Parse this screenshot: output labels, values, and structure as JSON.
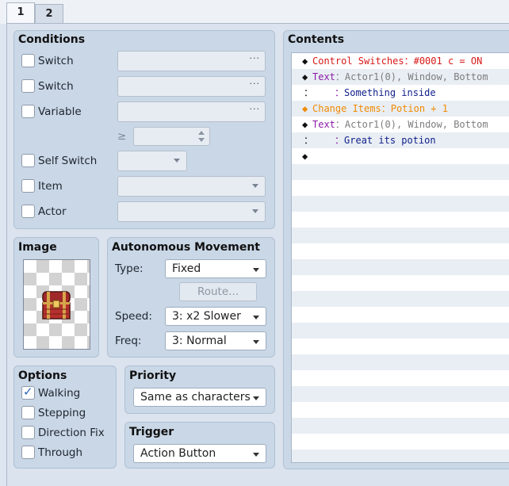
{
  "tabs": [
    "1",
    "2"
  ],
  "conditions": {
    "title": "Conditions",
    "switch1_label": "Switch",
    "switch2_label": "Switch",
    "variable_label": "Variable",
    "ge_symbol": "≥",
    "self_switch_label": "Self Switch",
    "item_label": "Item",
    "actor_label": "Actor",
    "ellipsis": "···"
  },
  "image": {
    "title": "Image",
    "icon": "treasure-chest"
  },
  "movement": {
    "title": "Autonomous Movement",
    "type_label": "Type:",
    "type_value": "Fixed",
    "route_label": "Route...",
    "speed_label": "Speed:",
    "speed_value": "3: x2 Slower",
    "freq_label": "Freq:",
    "freq_value": "3: Normal"
  },
  "options": {
    "title": "Options",
    "items": [
      {
        "label": "Walking",
        "checked": true
      },
      {
        "label": "Stepping",
        "checked": false
      },
      {
        "label": "Direction Fix",
        "checked": false
      },
      {
        "label": "Through",
        "checked": false
      }
    ]
  },
  "priority": {
    "title": "Priority",
    "value": "Same as characters"
  },
  "trigger": {
    "title": "Trigger",
    "value": "Action Button"
  },
  "contents": {
    "title": "Contents",
    "lines": [
      {
        "marker": "◆",
        "command": "Control Switches",
        "sep": "：",
        "args": "#0001 c = ON",
        "command_color": "#d81818",
        "args_color": "#d81818"
      },
      {
        "marker": "◆",
        "command": "Text",
        "sep": "：",
        "args": "Actor1(0), Window, Bottom",
        "command_color": "#8d1aa8",
        "args_color": "#7d7d7d"
      },
      {
        "marker": "：",
        "command": "",
        "sep": "：",
        "args": "Something inside",
        "command_color": "#8d1aa8",
        "args_color": "#10208a"
      },
      {
        "marker": "◆",
        "command": "Change Items",
        "sep": "：",
        "args": "Potion + 1",
        "command_color": "#f08a00",
        "args_color": "#f08a00"
      },
      {
        "marker": "◆",
        "command": "Text",
        "sep": "：",
        "args": "Actor1(0), Window, Bottom",
        "command_color": "#8d1aa8",
        "args_color": "#7d7d7d"
      },
      {
        "marker": "：",
        "command": "",
        "sep": "：",
        "args": "Great its potion",
        "command_color": "#8d1aa8",
        "args_color": "#10208a"
      },
      {
        "marker": "◆",
        "command": "",
        "sep": "",
        "args": "",
        "command_color": "#111111",
        "args_color": "#111111"
      }
    ]
  }
}
